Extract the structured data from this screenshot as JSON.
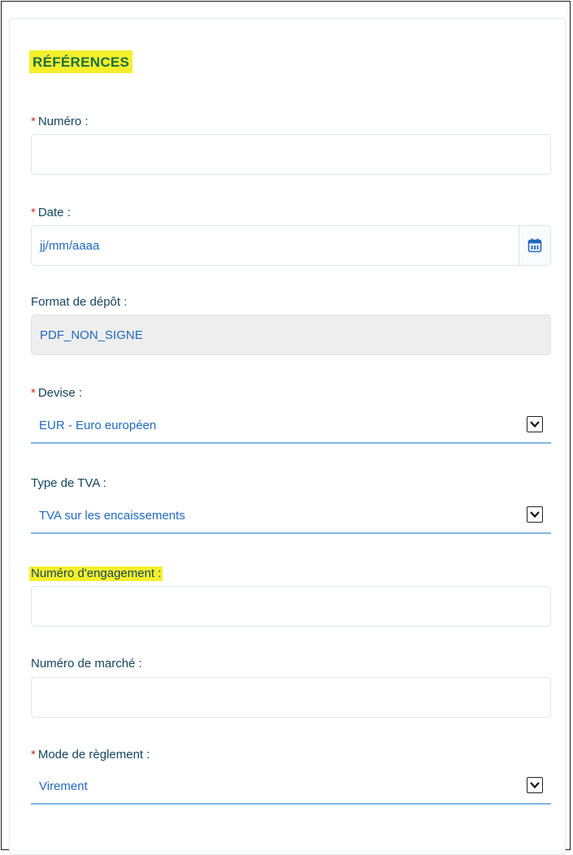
{
  "section": {
    "title": "RÉFÉRENCES"
  },
  "fields": {
    "numero": {
      "required_mark": "*",
      "label": "Numéro :",
      "value": ""
    },
    "date": {
      "required_mark": "*",
      "label": "Date :",
      "placeholder": "jj/mm/aaaa"
    },
    "format_depot": {
      "label": "Format de dépôt :",
      "value": "PDF_NON_SIGNE"
    },
    "devise": {
      "required_mark": "*",
      "label": "Devise :",
      "value": "EUR - Euro européen"
    },
    "type_tva": {
      "label": "Type de TVA :",
      "value": "TVA sur les encaissements"
    },
    "numero_engagement": {
      "label": "Numéro d'engagement :",
      "value": ""
    },
    "numero_marche": {
      "label": "Numéro de marché :",
      "value": ""
    },
    "mode_reglement": {
      "required_mark": "*",
      "label": "Mode de règlement :",
      "value": "Virement"
    }
  },
  "icons": {
    "date_picker": "calendar-icon",
    "dropdown": "chevron-down-icon"
  },
  "colors": {
    "highlight": "#f5ef2b",
    "title_green": "#1c6f45",
    "label_navy": "#14455f",
    "value_blue": "#1f69bf",
    "required_red": "#d22c2c",
    "select_underline": "#7fb6e8"
  }
}
